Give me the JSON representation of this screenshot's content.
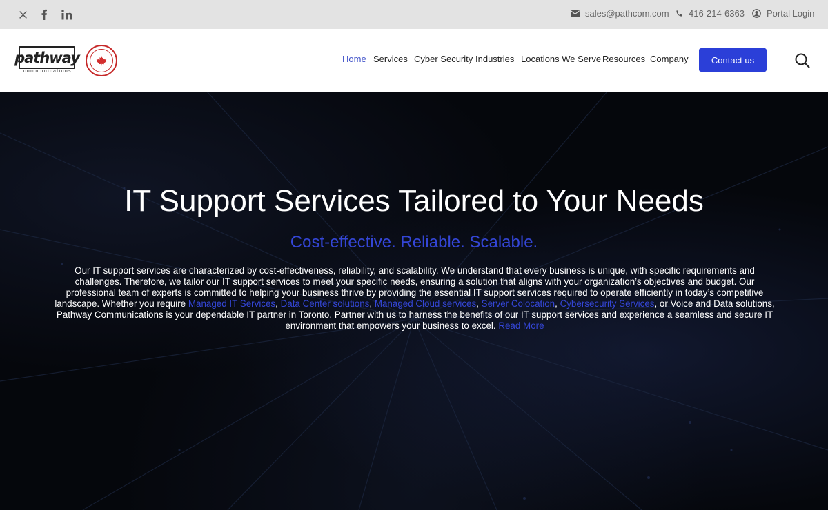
{
  "topbar": {
    "email": "sales@pathcom.com",
    "phone": "416-214-6363",
    "portal": "Portal Login",
    "social_icons": [
      "x-icon",
      "facebook-icon",
      "linkedin-icon"
    ]
  },
  "header": {
    "logo_text": "pathway",
    "logo_subtext": "communications",
    "nav": [
      "Home",
      "Services",
      "Cyber Security",
      "Industries",
      "Locations We Serve",
      "Resources",
      "Company"
    ],
    "active_nav": "Home",
    "cta": "Contact us"
  },
  "hero": {
    "title": "IT Support Services Tailored to Your Needs",
    "subtitle": "Cost-effective. Reliable. Scalable.",
    "body": {
      "p1": "Our IT support services are characterized by cost-effectiveness, reliability, and scalability. We understand that every business is unique, with specific requirements and challenges. Therefore, we tailor our IT support services to meet your specific needs, ensuring a solution that aligns with your organization’s objectives and budget. Our professional team of experts is committed to helping your business thrive by providing the essential IT support services required to operate efficiently in today’s competitive landscape. Whether you require ",
      "link1": "Managed IT Services",
      "sep1": ", ",
      "link2": "Data Center solutions",
      "sep2": ", ",
      "link3": "Managed Cloud services",
      "sep3": ", ",
      "link4": "Server Colocation",
      "sep4": ", ",
      "link5": "Cybersecurity Services",
      "p2": ", or Voice and Data solutions, Pathway Communications is your dependable IT partner in Toronto. Partner with us to harness the benefits of our IT support services and experience a seamless and secure IT environment that empowers your business to excel. ",
      "read_more": "Read More"
    }
  },
  "colors": {
    "accent": "#2b3fd8",
    "link": "#3446d6",
    "topbar_bg": "#e3e3e3",
    "hero_bg": "#05070c"
  }
}
